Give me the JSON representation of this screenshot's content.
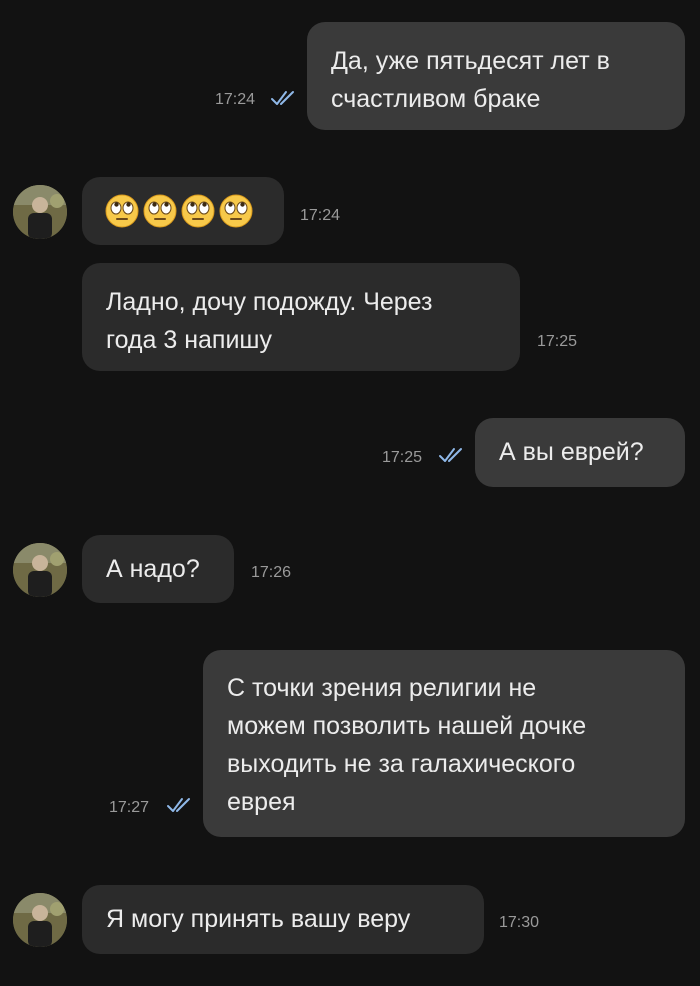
{
  "messages": [
    {
      "id": "m1",
      "direction": "outgoing",
      "text_lines": [
        "Да, уже пятьдесят лет в",
        "счастливом браке"
      ],
      "time": "17:24",
      "read": true
    },
    {
      "id": "m2",
      "direction": "incoming",
      "emoji": [
        "face-with-rolling-eyes",
        "face-with-rolling-eyes",
        "face-with-rolling-eyes",
        "face-with-rolling-eyes"
      ],
      "time": "17:24"
    },
    {
      "id": "m3",
      "direction": "incoming",
      "text_lines": [
        "Ладно, дочу подожду. Через",
        "года 3 напишу"
      ],
      "time": "17:25"
    },
    {
      "id": "m4",
      "direction": "outgoing",
      "text_lines": [
        "А вы еврей?"
      ],
      "time": "17:25",
      "read": true
    },
    {
      "id": "m5",
      "direction": "incoming",
      "text_lines": [
        "А надо?"
      ],
      "time": "17:26"
    },
    {
      "id": "m6",
      "direction": "outgoing",
      "text_lines": [
        "С точки зрения религии не",
        "можем позволить нашей дочке",
        "выходить не за галахического",
        "еврея"
      ],
      "time": "17:27",
      "read": true
    },
    {
      "id": "m7",
      "direction": "incoming",
      "text_lines": [
        "Я могу принять вашу веру"
      ],
      "time": "17:30"
    }
  ],
  "colors": {
    "background": "#121212",
    "outgoing_bubble": "#3a3a3a",
    "incoming_bubble": "#2b2b2b",
    "read_ticks": "#8fb8e8",
    "time_text": "#9a9a9a"
  },
  "icons": {
    "read_receipt": "double-check-icon",
    "contact_avatar": "avatar"
  }
}
